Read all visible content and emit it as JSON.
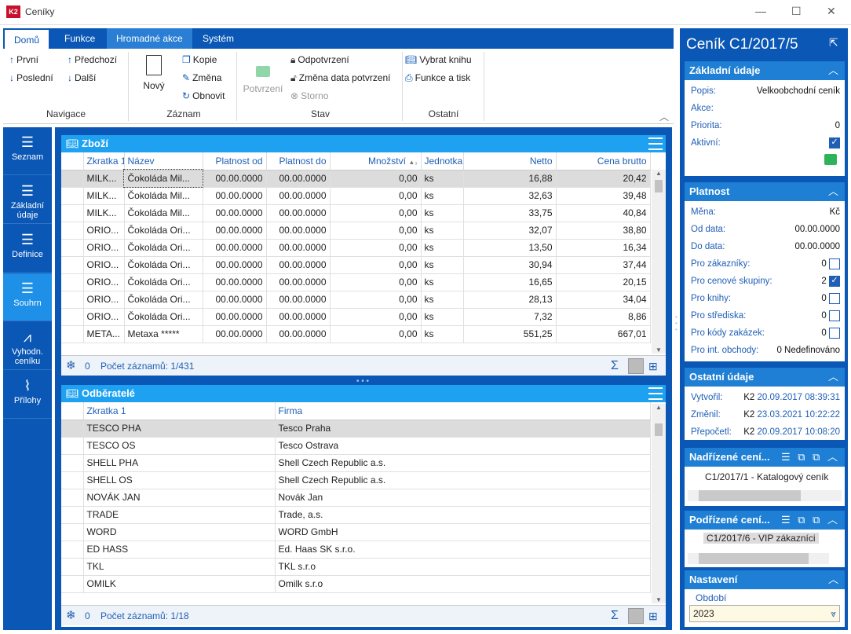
{
  "window": {
    "title": "Ceníky",
    "app_icon": "K2"
  },
  "ribbon": {
    "tabs": [
      "Domů",
      "Funkce",
      "Hromadné akce",
      "Systém"
    ],
    "navigace": {
      "prvni": "První",
      "predchozi": "Předchozí",
      "posledni": "Poslední",
      "dalsi": "Další",
      "label": "Navigace"
    },
    "zaznam": {
      "novy": "Nový",
      "kopie": "Kopie",
      "zmena": "Změna",
      "obnovit": "Obnovit",
      "label": "Záznam"
    },
    "stav": {
      "potvrzeni": "Potvrzení",
      "odpotvrzeni": "Odpotvrzení",
      "zmena_data": "Změna data potvrzení",
      "storno": "Storno",
      "label": "Stav"
    },
    "ostatni": {
      "vybrat_knihu": "Vybrat knihu",
      "funkce_tisk": "Funkce a tisk",
      "label": "Ostatní"
    }
  },
  "leftnav": [
    "Seznam",
    "Základní údaje",
    "Definice",
    "Souhrn",
    "Vyhodn. ceníku",
    "Přílohy"
  ],
  "zbozi": {
    "title": "Zboží",
    "columns": [
      "Zkratka 1",
      "Název",
      "Platnost od",
      "Platnost do",
      "Množství",
      "Jednotka",
      "Netto",
      "Cena brutto"
    ],
    "rows": [
      [
        "MILK...",
        "Čokoláda Mil...",
        "00.00.0000",
        "00.00.0000",
        "0,00",
        "ks",
        "16,88",
        "20,42"
      ],
      [
        "MILK...",
        "Čokoláda Mil...",
        "00.00.0000",
        "00.00.0000",
        "0,00",
        "ks",
        "32,63",
        "39,48"
      ],
      [
        "MILK...",
        "Čokoláda Mil...",
        "00.00.0000",
        "00.00.0000",
        "0,00",
        "ks",
        "33,75",
        "40,84"
      ],
      [
        "ORIO...",
        "Čokoláda Ori...",
        "00.00.0000",
        "00.00.0000",
        "0,00",
        "ks",
        "32,07",
        "38,80"
      ],
      [
        "ORIO...",
        "Čokoláda Ori...",
        "00.00.0000",
        "00.00.0000",
        "0,00",
        "ks",
        "13,50",
        "16,34"
      ],
      [
        "ORIO...",
        "Čokoláda Ori...",
        "00.00.0000",
        "00.00.0000",
        "0,00",
        "ks",
        "30,94",
        "37,44"
      ],
      [
        "ORIO...",
        "Čokoláda Ori...",
        "00.00.0000",
        "00.00.0000",
        "0,00",
        "ks",
        "16,65",
        "20,15"
      ],
      [
        "ORIO...",
        "Čokoláda Ori...",
        "00.00.0000",
        "00.00.0000",
        "0,00",
        "ks",
        "28,13",
        "34,04"
      ],
      [
        "ORIO...",
        "Čokoláda Ori...",
        "00.00.0000",
        "00.00.0000",
        "0,00",
        "ks",
        "7,32",
        "8,86"
      ],
      [
        "META...",
        "Metaxa *****",
        "00.00.0000",
        "00.00.0000",
        "0,00",
        "ks",
        "551,25",
        "667,01"
      ]
    ],
    "footer_count": "0",
    "footer_text": "Počet záznamů: 1/431"
  },
  "odberatele": {
    "title": "Odběratelé",
    "columns": [
      "Zkratka 1",
      "Firma"
    ],
    "rows": [
      [
        "TESCO PHA",
        "Tesco Praha"
      ],
      [
        "TESCO OS",
        "Tesco Ostrava"
      ],
      [
        "SHELL PHA",
        "Shell Czech Republic a.s."
      ],
      [
        "SHELL OS",
        "Shell Czech Republic a.s."
      ],
      [
        "NOVÁK JAN",
        "Novák Jan"
      ],
      [
        "TRADE",
        "Trade, a.s."
      ],
      [
        "WORD",
        "WORD GmbH"
      ],
      [
        "ED HASS",
        "Ed. Haas SK s.r.o."
      ],
      [
        "TKL",
        "TKL s.r.o"
      ],
      [
        "OMILK",
        "Omilk s.r.o"
      ]
    ],
    "footer_count": "0",
    "footer_text": "Počet záznamů: 1/18"
  },
  "right": {
    "title": "Ceník C1/2017/5",
    "zakladni": {
      "head": "Základní údaje",
      "popis_l": "Popis:",
      "popis_v": "Velkoobchodní ceník",
      "akce_l": "Akce:",
      "priorita_l": "Priorita:",
      "priorita_v": "0",
      "aktivni_l": "Aktivní:"
    },
    "platnost": {
      "head": "Platnost",
      "mena_l": "Měna:",
      "mena_v": "Kč",
      "od_l": "Od data:",
      "od_v": "00.00.0000",
      "do_l": "Do data:",
      "do_v": "00.00.0000",
      "zak_l": "Pro zákazníky:",
      "zak_v": "0",
      "skup_l": "Pro cenové skupiny:",
      "skup_v": "2",
      "kn_l": "Pro knihy:",
      "kn_v": "0",
      "str_l": "Pro střediska:",
      "str_v": "0",
      "kod_l": "Pro kódy zakázek:",
      "kod_v": "0",
      "int_l": "Pro int. obchody:",
      "int_v": "0 Nedefinováno"
    },
    "ostatni": {
      "head": "Ostatní údaje",
      "vyt_l": "Vytvořil:",
      "vyt_u": "K2",
      "vyt_v": "20.09.2017 08:39:31",
      "zm_l": "Změnil:",
      "zm_u": "K2",
      "zm_v": "23.03.2021 10:22:22",
      "pr_l": "Přepočetl:",
      "pr_u": "K2",
      "pr_v": "20.09.2017 10:08:20"
    },
    "nadrizene": {
      "head": "Nadřízené cení...",
      "item": "C1/2017/1 - Katalogový ceník"
    },
    "podrizene": {
      "head": "Podřízené cení...",
      "item": "C1/2017/6 - VIP zákazníci"
    },
    "nastaveni": {
      "head": "Nastavení",
      "obdobi_l": "Období",
      "obdobi_v": "2023"
    }
  }
}
